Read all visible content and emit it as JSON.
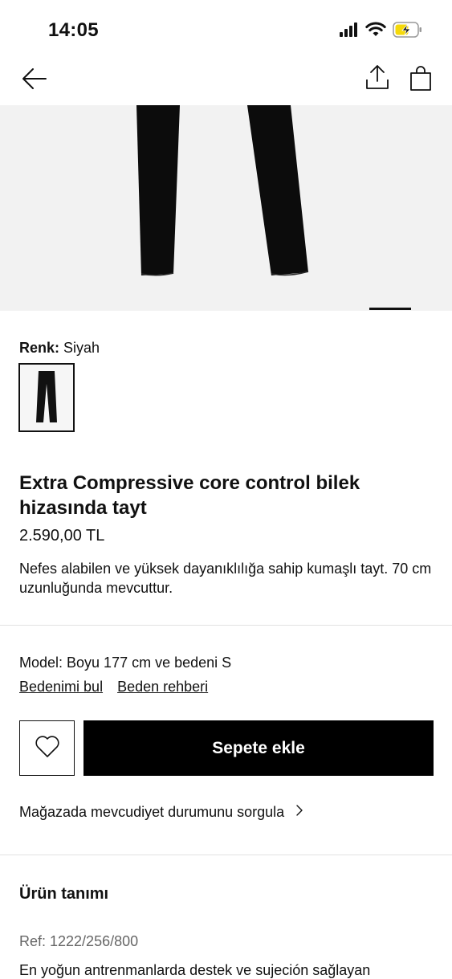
{
  "status_bar": {
    "time": "14:05"
  },
  "nav": {
    "back_icon": "arrow-left-icon",
    "share_icon": "share-upload-icon",
    "bag_icon": "shopping-bag-icon"
  },
  "gallery": {
    "current_slide_fraction": 1.0
  },
  "color": {
    "label": "Renk:",
    "value": "Siyah"
  },
  "product": {
    "title": "Extra Compressive core control bilek hizasında tayt",
    "price": "2.590,00 TL",
    "description": "Nefes alabilen ve yüksek dayanıklılığa sahip kumaşlı tayt. 70 cm uzunluğunda mevcuttur."
  },
  "sizing": {
    "model_info": "Model: Boyu 177 cm ve bedeni S",
    "find_size_link": "Bedenimi bul",
    "size_guide_link": "Beden rehberi"
  },
  "actions": {
    "wishlist_icon": "heart-icon",
    "add_to_cart": "Sepete ekle",
    "store_availability": "Mağazada mevcudiyet durumunu sorgula"
  },
  "details": {
    "section_title": "Ürün tanımı",
    "ref": "Ref: 1222/256/800",
    "long_description": "En yoğun antrenmanlarda destek ve sujeción sağlayan"
  },
  "colors": {
    "battery_charging": "#f5d90a",
    "button_bg": "#000000"
  }
}
